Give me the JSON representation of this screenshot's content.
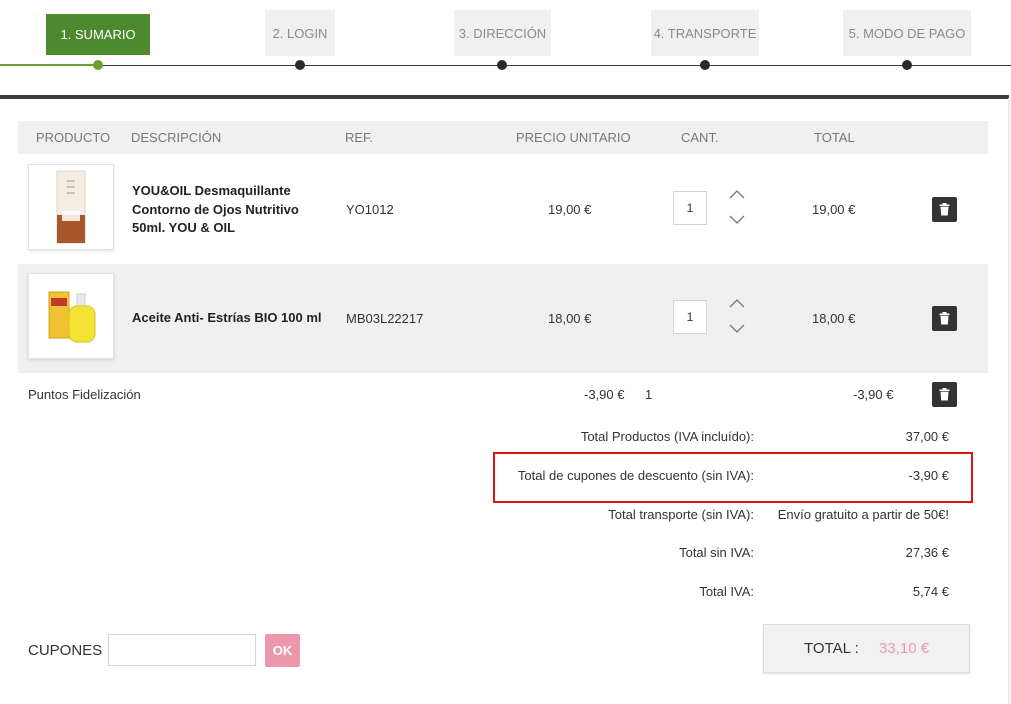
{
  "steps": [
    {
      "label": "1. Sumario",
      "active": true
    },
    {
      "label": "2. Login",
      "active": false
    },
    {
      "label": "3. Dirección",
      "active": false
    },
    {
      "label": "4. Transporte",
      "active": false
    },
    {
      "label": "5. Modo de pago",
      "active": false
    }
  ],
  "table": {
    "headers": {
      "product": "Producto",
      "description": "Descripción",
      "ref": "Ref.",
      "unit_price": "Precio unitario",
      "qty": "Cant.",
      "total": "Total"
    },
    "rows": [
      {
        "desc_lines": [
          "YOU&OIL Desmaquillante",
          "Contorno de Ojos Nutritivo",
          "50ml. YOU & OIL"
        ],
        "ref": "YO1012",
        "unit_price": "19,00 €",
        "qty": "1",
        "total": "19,00 €",
        "image_icon": "serum-bottle-box-icon"
      },
      {
        "desc_lines": [
          "Aceite Anti- Estrías BIO 100 ml"
        ],
        "ref": "MB03L22217",
        "unit_price": "18,00 €",
        "qty": "1",
        "total": "18,00 €",
        "image_icon": "oil-bottle-icon"
      }
    ]
  },
  "loyalty": {
    "label": "Puntos Fidelización",
    "unit_price": "-3,90 €",
    "qty": "1",
    "total": "-3,90 €"
  },
  "summary": [
    {
      "label": "Total Productos (IVA incluído):",
      "value": "37,00 €"
    },
    {
      "label": "Total de cupones de descuento (sin IVA):",
      "value": "-3,90 €"
    },
    {
      "label": "Total transporte (sin IVA):",
      "value": "Envío gratuito a partir de 50€!"
    },
    {
      "label": "Total sin IVA:",
      "value": "27,36 €"
    },
    {
      "label": "Total IVA:",
      "value": "5,74 €"
    }
  ],
  "coupons": {
    "label": "CUPONES",
    "placeholder": "",
    "ok_label": "OK"
  },
  "grand_total": {
    "label": "TOTAL :",
    "value": "33,10 €"
  },
  "colors": {
    "accent_green": "#4d8a2f",
    "total_pink": "#eb98ad",
    "highlight_red": "#dc1414"
  }
}
